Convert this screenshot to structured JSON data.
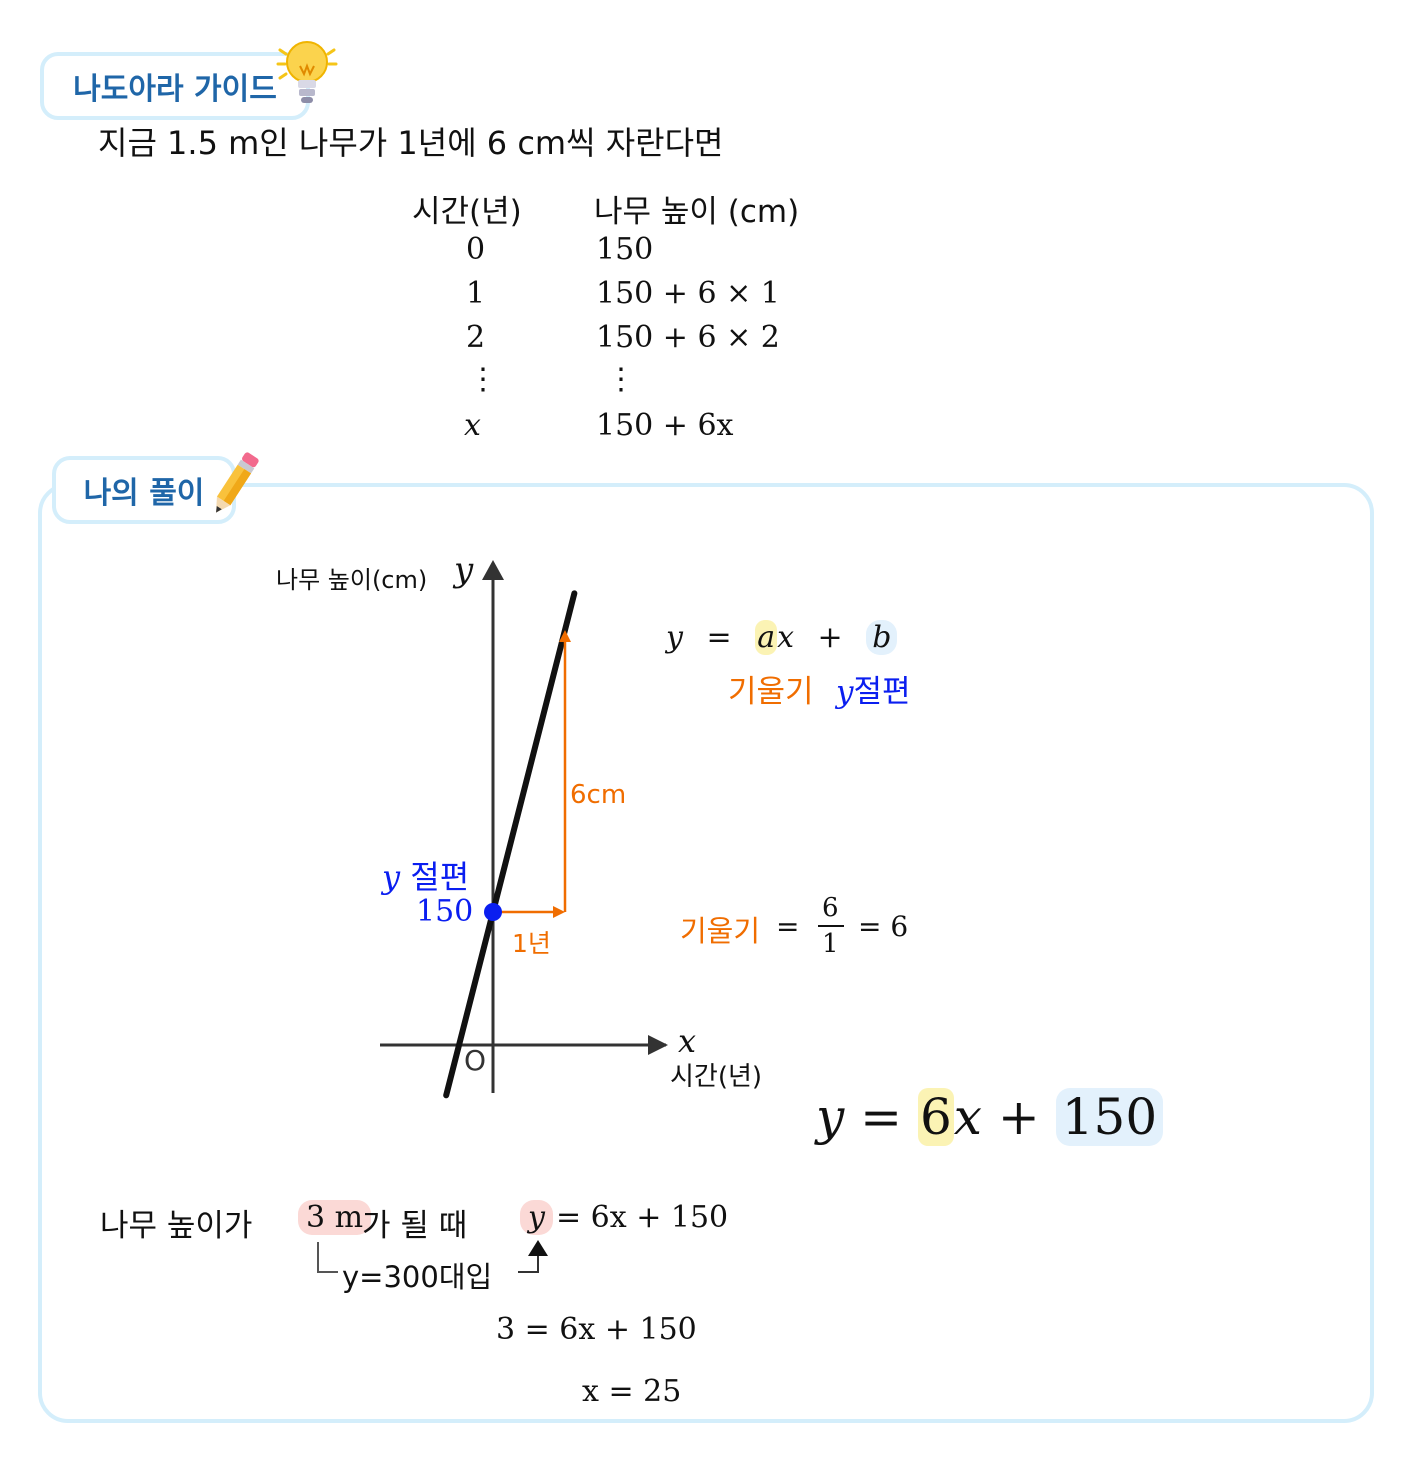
{
  "guide": {
    "tag": "나도아라 가이드",
    "intro": "지금 1.5 m인 나무가 1년에 6 cm씩 자란다면",
    "table": {
      "headers": [
        "시간(년)",
        "나무 높이 (cm)"
      ],
      "rows": [
        [
          "0",
          "150"
        ],
        [
          "1",
          "150 + 6 × 1"
        ],
        [
          "2",
          "150 + 6 × 2"
        ],
        [
          "⋮",
          "⋮"
        ],
        [
          "x",
          "150 + 6x"
        ]
      ]
    }
  },
  "solution": {
    "tag": "나의 풀이",
    "graph": {
      "y_axis_label": "나무 높이(cm)",
      "y_var": "y",
      "x_var": "x",
      "x_axis_label": "시간(년)",
      "origin": "O",
      "y_intercept_label_var": "y",
      "y_intercept_label": "절편",
      "y_intercept_value": "150",
      "rise_label": "6cm",
      "run_label": "1년",
      "line": {
        "slope": 6,
        "intercept": 150
      }
    },
    "formula": {
      "y": "y",
      "eq": "=",
      "a": "a",
      "x": "x",
      "plus": "+",
      "b": "b",
      "slope_word": "기울기",
      "intercept_var": "y",
      "intercept_word": "절편"
    },
    "slope_calc": {
      "word": "기울기",
      "eq": "=",
      "numerator": "6",
      "denominator": "1",
      "result": "= 6"
    },
    "final_equation": {
      "y": "y",
      "eq": "=",
      "coef": "6",
      "x": "x",
      "plus": "+",
      "const": "150"
    },
    "steps": {
      "prefix": "나무 높이가",
      "height": "3 m",
      "suffix": "가 될 때",
      "y": "y",
      "eq_rest": "= 6x + 150",
      "substitute": "y=300대입",
      "line2": "3 = 6x + 150",
      "line3": "x = 25"
    }
  },
  "colors": {
    "tag_border": "#d4eefb",
    "tag_text": "#1f66a8",
    "slope_orange": "#f06d00",
    "intercept_blue": "#0a1ef0",
    "highlight_yellow": "#fbf3b4",
    "highlight_blue": "#e3f1fc",
    "highlight_pink": "#fbd9d6"
  },
  "icons": [
    "lightbulb-icon",
    "pencil-icon"
  ]
}
